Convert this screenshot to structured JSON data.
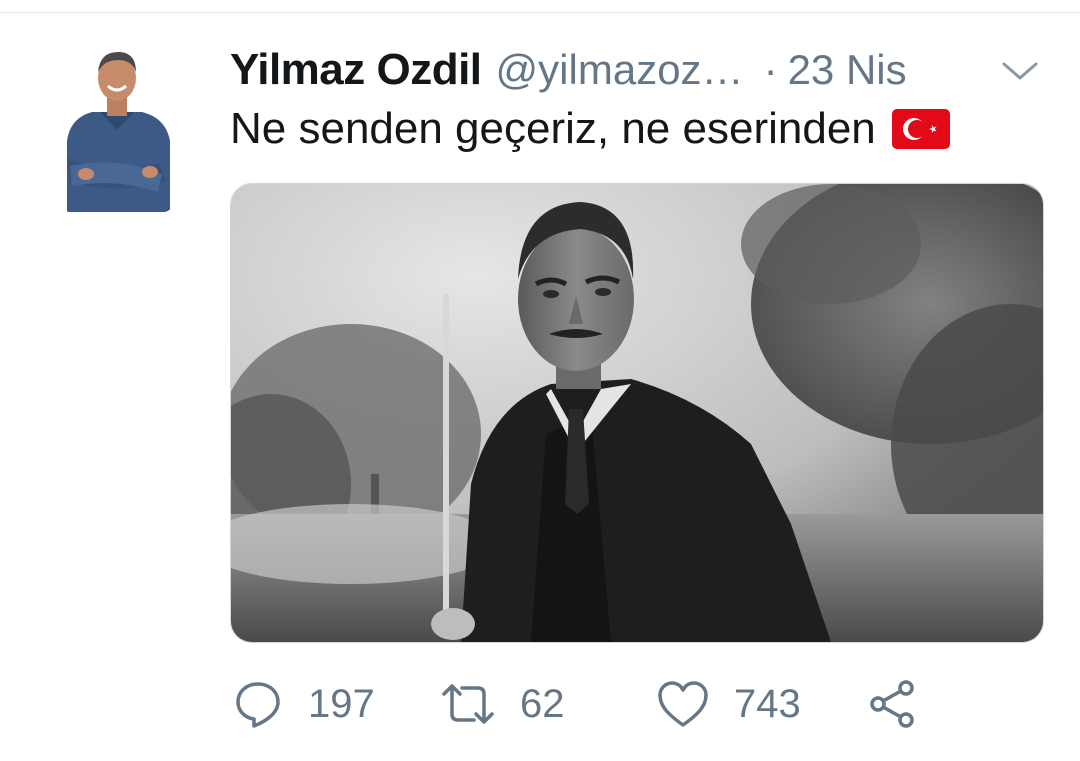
{
  "tweet": {
    "display_name": "Yilmaz Ozdil",
    "handle": "@yilmazoz…",
    "separator": "·",
    "date": "23 Nis",
    "text": "Ne senden geçeriz, ne eserinden",
    "emoji_icon": "turkey-flag-icon"
  },
  "actions": {
    "reply_count": "197",
    "retweet_count": "62",
    "like_count": "743"
  },
  "colors": {
    "text_primary": "#14171a",
    "text_secondary": "#657786",
    "flag_red": "#e30a17",
    "divider": "#e1e8ed"
  }
}
